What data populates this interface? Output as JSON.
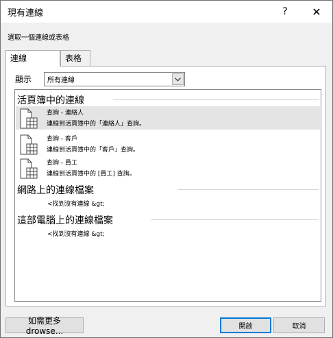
{
  "window": {
    "title": "現有連線",
    "help": "?",
    "close": "✕"
  },
  "instruction": "選取一個連線或表格",
  "tabs": [
    {
      "label": "連線"
    },
    {
      "label": "表格"
    }
  ],
  "show": {
    "label": "顯示",
    "selected": "所有連線"
  },
  "groups": [
    {
      "title": "活頁簿中的連線",
      "items": [
        {
          "name": "查詢 - 連絡人",
          "desc": "連線到活頁簿中的「連絡人」查詢。"
        },
        {
          "name": "查詢 - 客戶",
          "desc": "連線到活頁簿中的「客戶」查詢。"
        },
        {
          "name": "查詢 - 員工",
          "desc": "連線到活頁簿中的 [員工] 查詢。"
        }
      ]
    },
    {
      "title": "網路上的連線檔案",
      "empty": "<找到沒有連線 &gt;"
    },
    {
      "title": "這部電腦上的連線檔案",
      "empty": "<找到沒有連線 &gt;"
    }
  ],
  "buttons": {
    "browse": "如需更多 drowse...",
    "open": "開啟",
    "cancel": "取消"
  }
}
